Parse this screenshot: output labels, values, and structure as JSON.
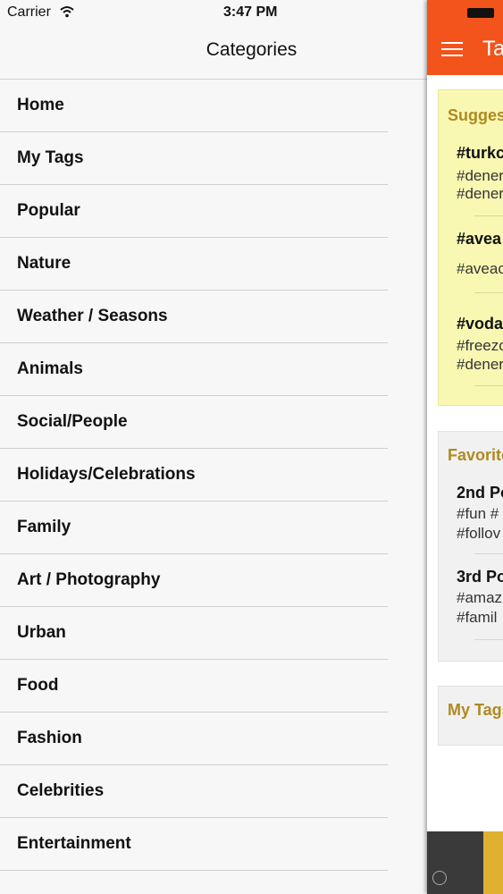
{
  "status_bar": {
    "carrier": "Carrier",
    "time": "3:47 PM"
  },
  "title": "Categories",
  "categories": [
    "Home",
    "My Tags",
    "Popular",
    "Nature",
    "Weather / Seasons",
    "Animals",
    "Social/People",
    "Holidays/Celebrations",
    "Family",
    "Art / Photography",
    "Urban",
    "Food",
    "Fashion",
    "Celebrities",
    "Entertainment"
  ],
  "main": {
    "title": "Ta",
    "suggested": {
      "heading": "Sugges",
      "entries": [
        {
          "title": "#turkc",
          "lines": [
            "#dener",
            "#dener"
          ]
        },
        {
          "title": "#avea",
          "lines": [
            "#aveac"
          ]
        },
        {
          "title": "#vodaf",
          "lines": [
            "#freezo",
            "#dener"
          ]
        }
      ]
    },
    "favorites": {
      "heading": "Favorite",
      "entries": [
        {
          "title": "2nd Po",
          "lines": [
            "#fun #",
            "#follov"
          ]
        },
        {
          "title": "3rd Po",
          "lines": [
            "#amaz",
            "#famil"
          ]
        }
      ]
    },
    "my_tags": {
      "heading": "My Tags"
    }
  },
  "colors": {
    "accent": "#f2541b",
    "heading": "#b08a20",
    "suggest_bg": "#f9f8b3"
  }
}
